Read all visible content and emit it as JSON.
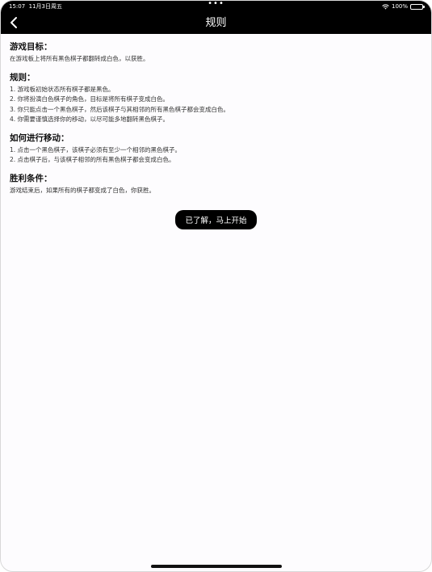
{
  "status": {
    "time": "15:07",
    "date": "11月3日周五",
    "dots": "•••",
    "battery": "100%"
  },
  "nav": {
    "title": "规则"
  },
  "sections": [
    {
      "heading": "游戏目标：",
      "lines": [
        "在游戏板上将所有黑色棋子都翻转成白色，以获胜。"
      ]
    },
    {
      "heading": "规则：",
      "lines": [
        "1. 游戏板初始状态所有棋子都是黑色。",
        "2. 你将扮演白色棋子的角色，目标是将所有棋子变成白色。",
        "3. 你只能点击一个黑色棋子，然后该棋子与其相邻的所有黑色棋子都会变成白色。",
        "4. 你需要谨慎选择你的移动，以尽可能多地翻转黑色棋子。"
      ]
    },
    {
      "heading": "如何进行移动：",
      "lines": [
        "1. 点击一个黑色棋子，该棋子必须有至少一个相邻的黑色棋子。",
        "2. 点击棋子后，与该棋子相邻的所有黑色棋子都会变成白色。"
      ]
    },
    {
      "heading": "胜利条件：",
      "lines": [
        "游戏结束后，如果所有的棋子都变成了白色，你获胜。"
      ]
    }
  ],
  "cta": {
    "label": "已了解，马上开始"
  }
}
